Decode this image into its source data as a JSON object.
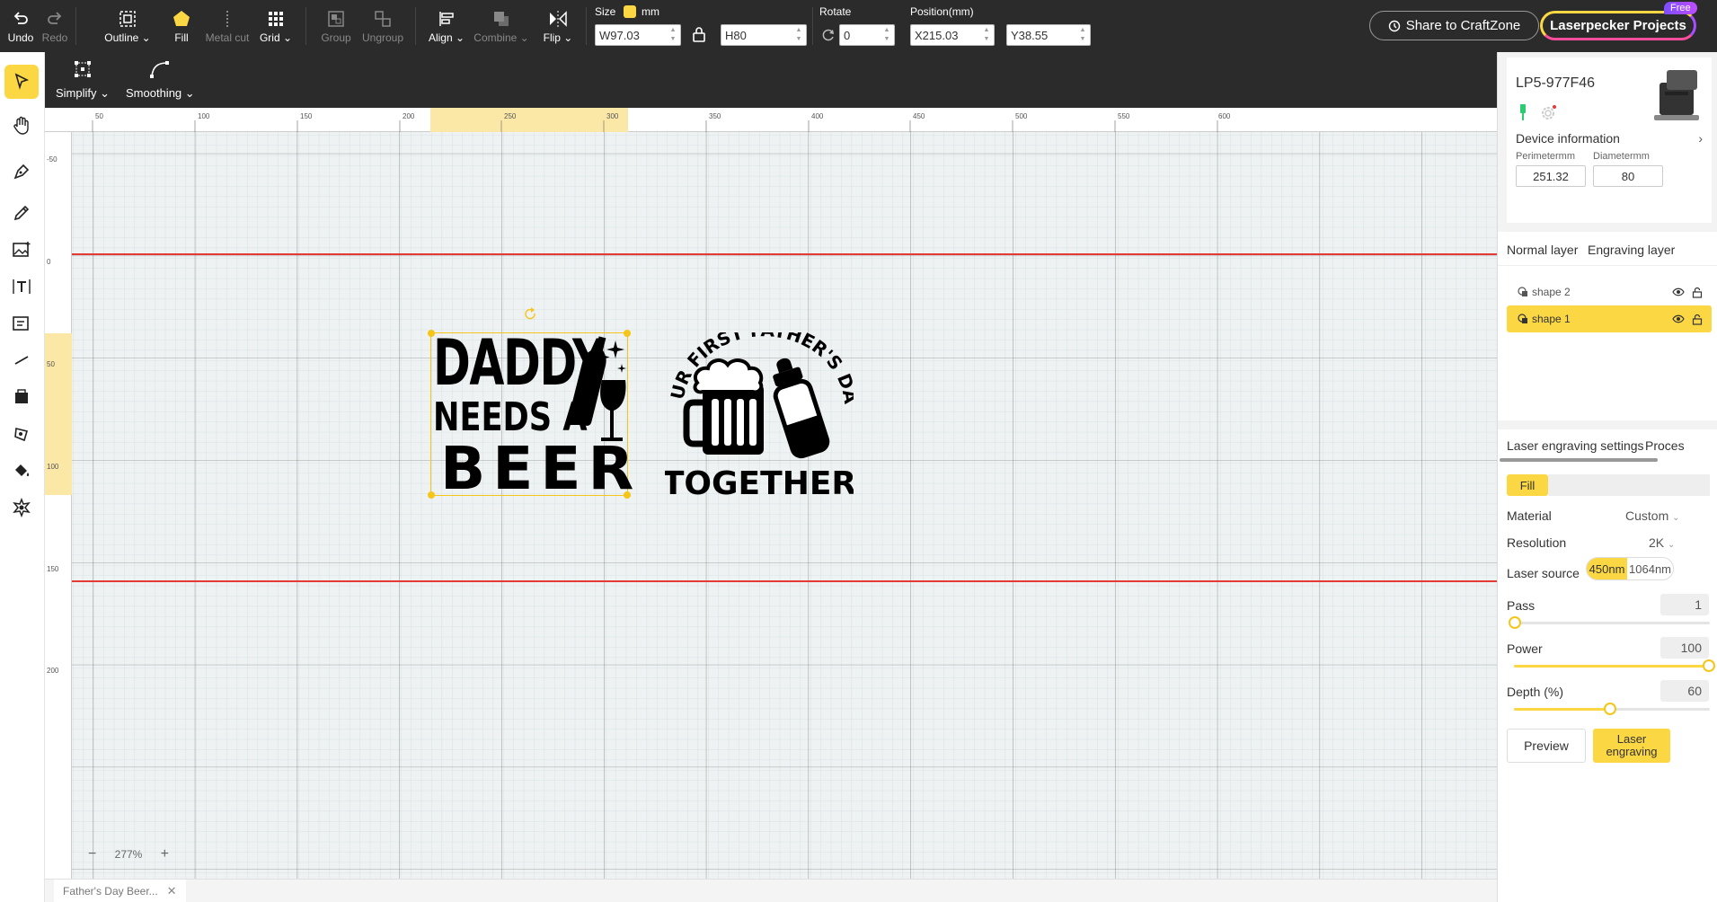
{
  "toolbar": {
    "undo": "Undo",
    "redo": "Redo",
    "outline": "Outline",
    "fill": "Fill",
    "metal_cut": "Metal cut",
    "grid": "Grid",
    "group": "Group",
    "ungroup": "Ungroup",
    "align": "Align",
    "combine": "Combine",
    "flip": "Flip",
    "size_label": "Size",
    "size_unit": "mm",
    "width_value": "W97.03",
    "height_value": "H80",
    "rotate_label": "Rotate",
    "rotate_value": "0",
    "position_label": "Position(mm)",
    "x_value": "X215.03",
    "y_value": "Y38.55",
    "share": "Share to CraftZone",
    "projects": "Laserpecker Projects",
    "free_badge": "Free"
  },
  "subbar": {
    "simplify": "Simplify",
    "smoothing": "Smoothing"
  },
  "left_tools": [
    {
      "name": "select-tool",
      "icon": "cursor-arrow-icon"
    },
    {
      "name": "hand-tool",
      "icon": "hand-icon"
    },
    {
      "name": "pen-tool",
      "icon": "pen-nib-icon"
    },
    {
      "name": "pencil-tool",
      "icon": "pencil-icon"
    },
    {
      "name": "image-tool",
      "icon": "image-icon"
    },
    {
      "name": "text-tool",
      "icon": "text-icon"
    },
    {
      "name": "curved-text-tool",
      "icon": "curved-text-icon"
    },
    {
      "name": "line-tool",
      "icon": "line-icon"
    },
    {
      "name": "shape-tool",
      "icon": "shape-icon"
    },
    {
      "name": "polygon-tool",
      "icon": "polygon-icon"
    },
    {
      "name": "fill-tool",
      "icon": "paint-bucket-icon"
    },
    {
      "name": "material-tool",
      "icon": "badge-icon"
    }
  ],
  "ruler": {
    "top_ticks": [
      "50",
      "100",
      "150",
      "200",
      "250",
      "300",
      "350",
      "400",
      "450",
      "500",
      "550",
      "600"
    ],
    "left_ticks": [
      "-50",
      "0",
      "50",
      "100",
      "150",
      "200"
    ]
  },
  "canvas": {
    "zoom": "277%",
    "artwork_left": {
      "line1": "DADDY",
      "line2": "NEEDS A",
      "line3": "BEER"
    },
    "artwork_right": {
      "arc": "OUR FIRST FATHER'S DAY",
      "bottom": "TOGETHER"
    }
  },
  "doc_tab": {
    "title": "Father's Day Beer..."
  },
  "device": {
    "name": "LP5-977F46",
    "info_label": "Device information",
    "perimeter_label": "Perimetermm",
    "perimeter_value": "251.32",
    "diameter_label": "Diametermm",
    "diameter_value": "80"
  },
  "layers": {
    "tab_normal": "Normal layer",
    "tab_engraving": "Engraving layer",
    "items": [
      {
        "label": "shape 2",
        "selected": false
      },
      {
        "label": "shape 1",
        "selected": true
      }
    ]
  },
  "settings": {
    "tab_laser": "Laser engraving settings",
    "tab_process": "Proces",
    "mode": "Fill",
    "material_label": "Material",
    "material_value": "Custom",
    "resolution_label": "Resolution",
    "resolution_value": "2K",
    "laser_source_label": "Laser source",
    "laser_450": "450nm",
    "laser_1064": "1064nm",
    "pass_label": "Pass",
    "pass_value": "1",
    "power_label": "Power",
    "power_value": "100",
    "depth_label": "Depth (%)",
    "depth_value": "60",
    "preview": "Preview",
    "laser_engraving": "Laser engraving"
  },
  "colors": {
    "accent": "#fbd744",
    "toolbar_bg": "#2b2b2b",
    "guide_red": "#e53935"
  }
}
